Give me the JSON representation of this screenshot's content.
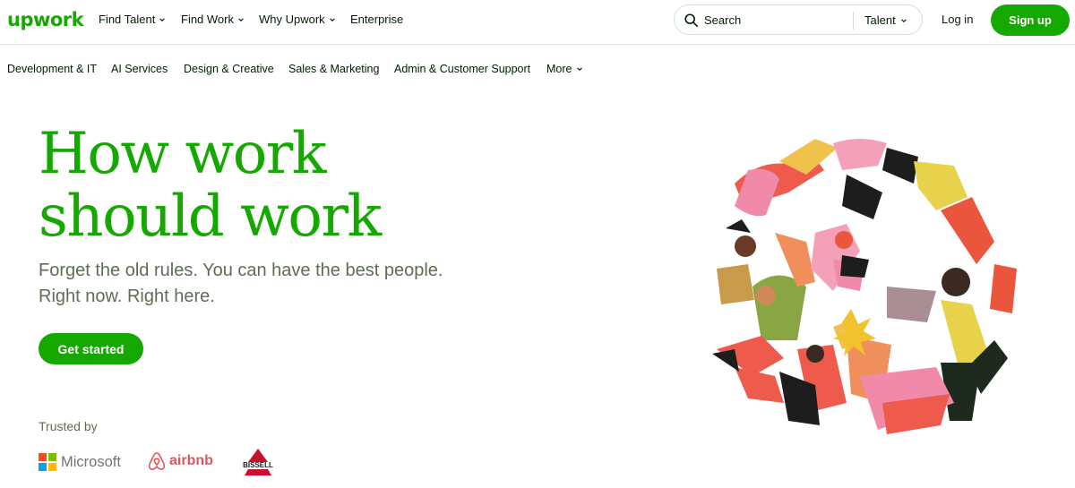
{
  "brand": {
    "logo_text": "upwork",
    "color": "#14a800"
  },
  "topnav": {
    "items": [
      {
        "label": "Find Talent",
        "has_dropdown": true
      },
      {
        "label": "Find Work",
        "has_dropdown": true
      },
      {
        "label": "Why Upwork",
        "has_dropdown": true
      },
      {
        "label": "Enterprise",
        "has_dropdown": false
      }
    ],
    "search": {
      "placeholder": "Search",
      "type_label": "Talent"
    },
    "login_label": "Log in",
    "signup_label": "Sign up"
  },
  "categories": {
    "items": [
      "Development & IT",
      "AI Services",
      "Design & Creative",
      "Sales & Marketing",
      "Admin & Customer Support"
    ],
    "more_label": "More"
  },
  "hero": {
    "title_line1": "How work",
    "title_line2": "should work",
    "subtitle_line1": "Forget the old rules. You can have the best people.",
    "subtitle_line2": "Right now. Right here.",
    "cta_label": "Get started"
  },
  "trusted": {
    "label": "Trusted by",
    "logos": [
      {
        "name": "Microsoft",
        "text": "Microsoft"
      },
      {
        "name": "Airbnb",
        "text": "airbnb"
      },
      {
        "name": "Bissell",
        "text": "BISSELL"
      }
    ]
  },
  "colors": {
    "accent": "#14a800",
    "text": "#001e00",
    "muted": "#5e6d55"
  }
}
